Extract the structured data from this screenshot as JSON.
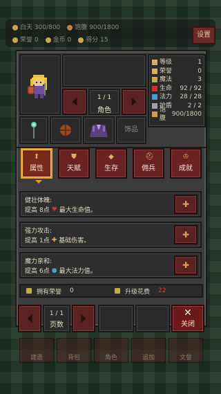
{
  "topbar": {
    "day_label": "白天",
    "day_value": "300/800",
    "hunger_label": "饱腹",
    "hunger_value": "900/1800",
    "honor_label": "荣誉",
    "honor_value": "0",
    "gold_label": "金币",
    "gold_value": "0",
    "score_label": "得分",
    "score_value": "15",
    "settings_label": "设置"
  },
  "role": {
    "page": "1 / 1",
    "label": "角色"
  },
  "stats": [
    {
      "name": "等级",
      "value": "1",
      "color": "#d9b060"
    },
    {
      "name": "荣誉",
      "value": "0",
      "color": "#d9b060"
    },
    {
      "name": "魔法",
      "value": "3",
      "color": "#c9a94a"
    },
    {
      "name": "生命",
      "value": "92 / 92",
      "color": "#d03030"
    },
    {
      "name": "法力",
      "value": "28 / 28",
      "color": "#40a0d0"
    },
    {
      "name": "护盾",
      "value": "2 / 2",
      "color": "#a0a0b0"
    },
    {
      "name": "饱腹",
      "value": "900/1800",
      "color": "#d0a040"
    }
  ],
  "equipment": {
    "accessory_label": "饰品"
  },
  "tabs": [
    {
      "label": "属性",
      "icon": "up-arrow-icon",
      "active": true
    },
    {
      "label": "天赋",
      "icon": "shield-icon",
      "active": false
    },
    {
      "label": "生存",
      "icon": "diamond-icon",
      "active": false
    },
    {
      "label": "佣兵",
      "icon": "helmet-icon",
      "active": false
    },
    {
      "label": "成就",
      "icon": "trophy-icon",
      "active": false
    }
  ],
  "attributes": [
    {
      "title": "健壮体魄:",
      "desc_pre": "提高",
      "amount": "8点",
      "icon": "heart-icon",
      "desc_post": "最大生命值。",
      "icon_color": "#d03030"
    },
    {
      "title": "强力攻击:",
      "desc_pre": "提高",
      "amount": "1点",
      "icon": "sword-icon",
      "desc_post": "基础伤害。",
      "icon_color": "#e0b040"
    },
    {
      "title": "魔力亲和:",
      "desc_pre": "提高",
      "amount": "6点",
      "icon": "mana-drop-icon",
      "desc_post": "最大法力值。",
      "icon_color": "#40a0d0"
    }
  ],
  "summary": {
    "honor_label": "拥有荣誉",
    "honor_value": "0",
    "cost_label": "升级花费",
    "cost_value": "22"
  },
  "pager": {
    "page": "1 / 1",
    "label": "页数"
  },
  "close_label": "关闭",
  "menu": [
    "建造",
    "背包",
    "角色",
    "追加",
    "文誉"
  ]
}
